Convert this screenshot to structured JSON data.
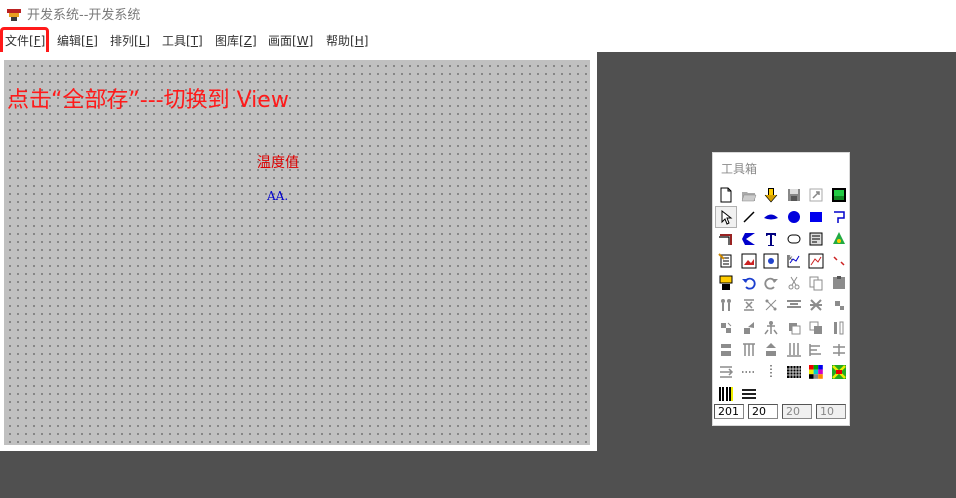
{
  "window": {
    "title": "开发系统--开发系统"
  },
  "menu": {
    "file": {
      "name": "文件",
      "key": "F"
    },
    "edit": {
      "name": "编辑",
      "key": "E"
    },
    "arrange": {
      "name": "排列",
      "key": "L"
    },
    "tools": {
      "name": "工具",
      "key": "T"
    },
    "library": {
      "name": "图库",
      "key": "Z"
    },
    "canvas": {
      "name": "画面",
      "key": "W"
    },
    "help": {
      "name": "帮助",
      "key": "H"
    }
  },
  "canvas": {
    "annotation": "点击“全部存”---切换到 View",
    "temperature_label": "温度值",
    "value_label": "AA."
  },
  "toolbox": {
    "title": "工具箱",
    "tools": [
      "new-file-icon",
      "open-folder-icon",
      "import-icon",
      "save-icon",
      "export-icon",
      "green-image-icon",
      "pointer-icon",
      "line-icon",
      "ellipse-arc-icon",
      "circle-icon",
      "rectangle-icon",
      "polyline-icon",
      "elbow-line-icon",
      "sector-icon",
      "text-icon",
      "rounded-rect-icon",
      "button-icon",
      "dots-icon",
      "doc-edit-icon",
      "bitmap-icon",
      "image-icon",
      "chart-icon",
      "trend-icon",
      "small-arrows-icon",
      "report-icon",
      "undo-icon",
      "redo-icon",
      "cut-icon",
      "copy-icon",
      "paste-icon",
      "align-left-icon",
      "align-center-icon",
      "align-right-icon",
      "align-middle-icon",
      "stretch-icon",
      "bring-front-icon",
      "send-back-icon",
      "rotate-icon",
      "group-icon",
      "ungroup-icon",
      "front-icon",
      "back-icon",
      "align-top-icon",
      "align-vcenter-icon",
      "align-hcenter-icon",
      "align-bottom-icon",
      "equal-width-icon",
      "equal-height-icon",
      "space-horizontal-icon",
      "dotted-line-icon",
      "vertical-dots-icon",
      "grid-icon",
      "color-palette-icon",
      "x-color-icon",
      "barcode-icon",
      "horizontal-lines-icon"
    ],
    "fields": [
      "201",
      "20",
      "20",
      "10"
    ]
  }
}
